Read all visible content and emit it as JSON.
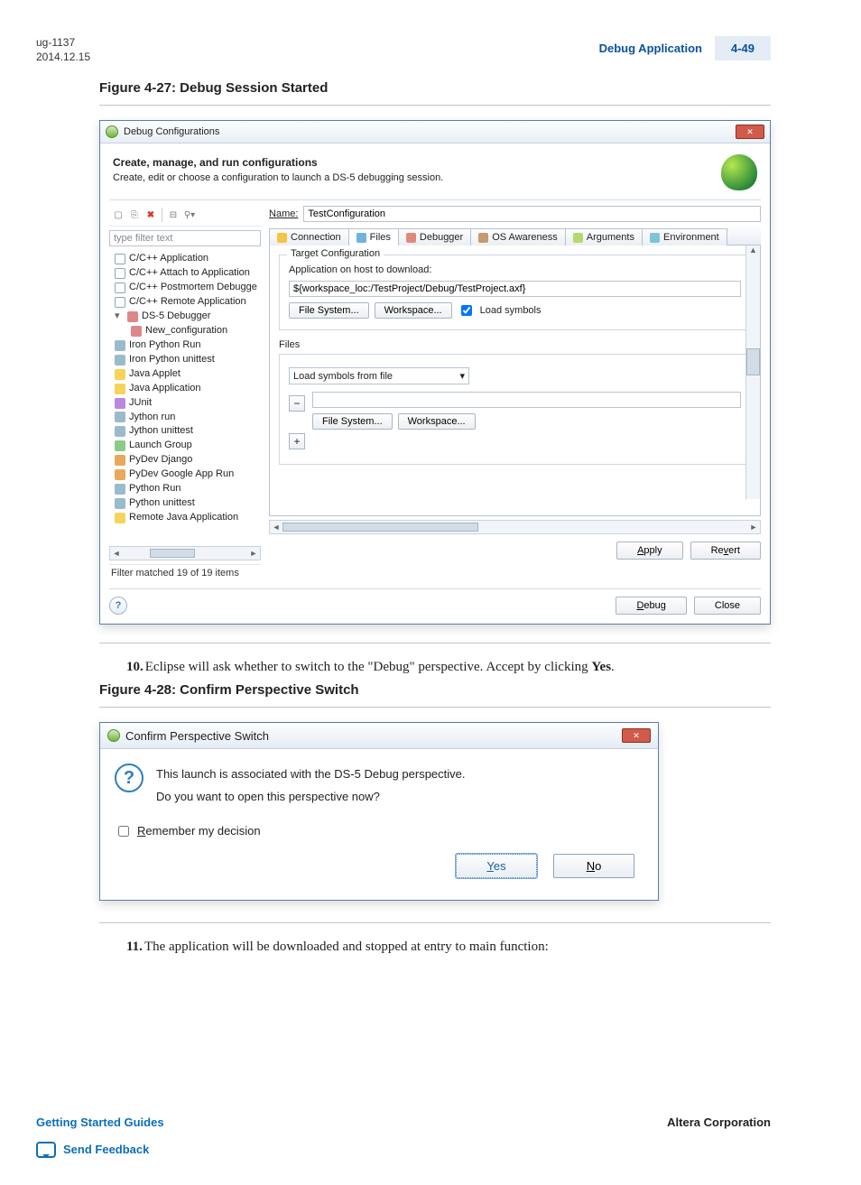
{
  "header": {
    "doc_id": "ug-1137",
    "doc_date": "2014.12.15",
    "section_title": "Debug Application",
    "page_number": "4-49"
  },
  "figure27": {
    "caption": "Figure 4-27: Debug Session Started",
    "window_title": "Debug Configurations",
    "heading_bold": "Create, manage, and run configurations",
    "heading_sub": "Create, edit or choose a configuration to launch a DS-5 debugging session.",
    "filter_placeholder": "type filter text",
    "tree_items": [
      "C/C++ Application",
      "C/C++ Attach to Application",
      "C/C++ Postmortem Debugge",
      "C/C++ Remote Application",
      "DS-5 Debugger",
      "New_configuration",
      "Iron Python Run",
      "Iron Python unittest",
      "Java Applet",
      "Java Application",
      "JUnit",
      "Jython run",
      "Jython unittest",
      "Launch Group",
      "PyDev Django",
      "PyDev Google App Run",
      "Python Run",
      "Python unittest",
      "Remote Java Application"
    ],
    "filter_status": "Filter matched 19 of 19 items",
    "name_label": "Name:",
    "name_value": "TestConfiguration",
    "tabs": [
      "Connection",
      "Files",
      "Debugger",
      "OS Awareness",
      "Arguments",
      "Environment"
    ],
    "target_group_legend": "Target Configuration",
    "app_host_label": "Application on host to download:",
    "app_host_value": "${workspace_loc:/TestProject/Debug/TestProject.axf}",
    "btn_file_system": "File System...",
    "btn_workspace": "Workspace...",
    "chk_load_symbols": "Load symbols",
    "files_legend": "Files",
    "load_symbols_from_file": "Load symbols from file",
    "btn_apply": "Apply",
    "btn_revert": "Revert",
    "btn_debug": "Debug",
    "btn_close": "Close"
  },
  "step10": {
    "num": "10.",
    "text_a": "Eclipse will ask whether to switch to the \"Debug\" perspective. Accept by clicking ",
    "text_b": "Yes",
    "text_c": "."
  },
  "figure28": {
    "caption": "Figure 4-28: Confirm Perspective Switch",
    "title": "Confirm Perspective Switch",
    "line1": "This launch is associated with the DS-5 Debug perspective.",
    "line2": "Do you want to open this perspective now?",
    "remember": "Remember my decision",
    "yes": "Yes",
    "no": "No"
  },
  "step11": {
    "num": "11.",
    "text": "The application will be downloaded and stopped at entry to main function:"
  },
  "footer": {
    "left": "Getting Started Guides",
    "right": "Altera Corporation",
    "feedback": "Send Feedback"
  }
}
